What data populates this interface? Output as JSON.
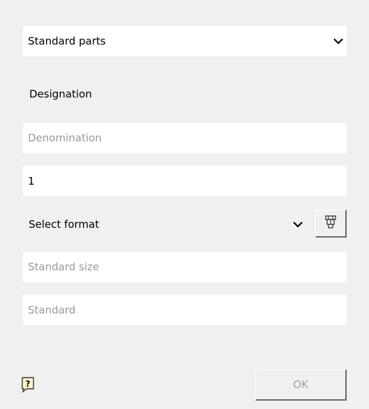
{
  "parts_dropdown": {
    "value": "Standard parts",
    "icon": "chevron-down-icon"
  },
  "designation": {
    "label": "Designation"
  },
  "denomination": {
    "placeholder": "Denomination"
  },
  "quantity": {
    "value": "1"
  },
  "format_dropdown": {
    "value": "Select format",
    "icon": "chevron-down-icon",
    "button_icon": "catalog-icon"
  },
  "standard_size": {
    "placeholder": "Standard size"
  },
  "standard": {
    "placeholder": "Standard"
  },
  "footer": {
    "help_icon": "help-icon",
    "ok_label": "OK"
  }
}
